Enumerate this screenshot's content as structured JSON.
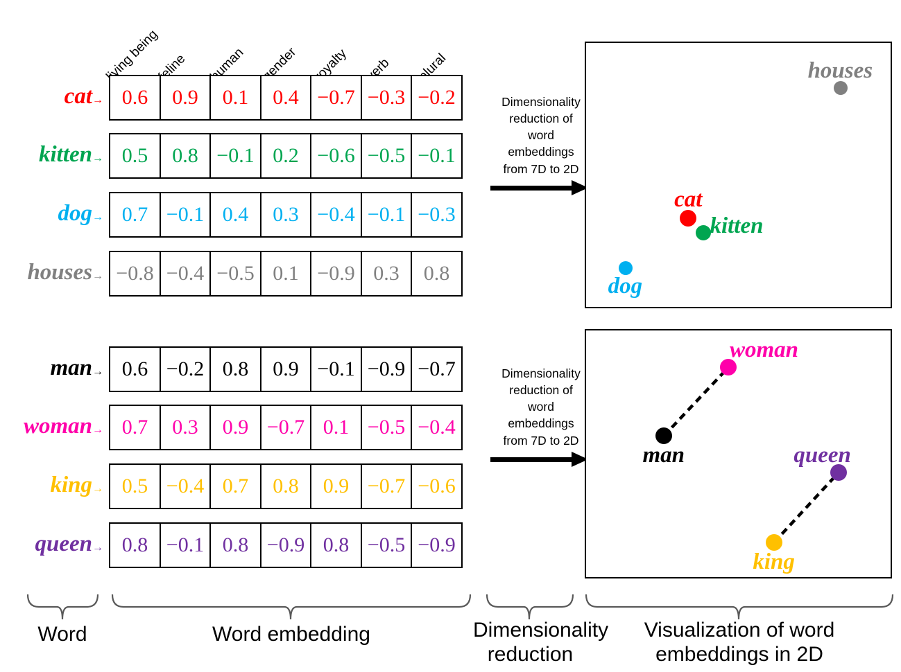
{
  "columns": [
    "living being",
    "feline",
    "human",
    "gender",
    "royalty",
    "verb",
    "plural"
  ],
  "group_top": {
    "rows": [
      {
        "word": "cat",
        "arrow": "→",
        "color": "#FF0000",
        "values": [
          "0.6",
          "0.9",
          "0.1",
          "0.4",
          "−0.7",
          "−0.3",
          "−0.2"
        ]
      },
      {
        "word": "kitten",
        "arrow": "→",
        "color": "#00A550",
        "values": [
          "0.5",
          "0.8",
          "−0.1",
          "0.2",
          "−0.6",
          "−0.5",
          "−0.1"
        ]
      },
      {
        "word": "dog",
        "arrow": "→",
        "color": "#00B0F0",
        "values": [
          "0.7",
          "−0.1",
          "0.4",
          "0.3",
          "−0.4",
          "−0.1",
          "−0.3"
        ]
      },
      {
        "word": "houses",
        "arrow": "→",
        "color": "#808080",
        "values": [
          "−0.8",
          "−0.4",
          "−0.5",
          "0.1",
          "−0.9",
          "0.3",
          "0.8"
        ]
      }
    ]
  },
  "group_bottom": {
    "rows": [
      {
        "word": "man",
        "arrow": "→",
        "color": "#000000",
        "values": [
          "0.6",
          "−0.2",
          "0.8",
          "0.9",
          "−0.1",
          "−0.9",
          "−0.7"
        ]
      },
      {
        "word": "woman",
        "arrow": "→",
        "color": "#FF00AA",
        "values": [
          "0.7",
          "0.3",
          "0.9",
          "−0.7",
          "0.1",
          "−0.5",
          "−0.4"
        ]
      },
      {
        "word": "king",
        "arrow": "→",
        "color": "#FFC000",
        "values": [
          "0.5",
          "−0.4",
          "0.7",
          "0.8",
          "0.9",
          "−0.7",
          "−0.6"
        ]
      },
      {
        "word": "queen",
        "arrow": "→",
        "color": "#7030A0",
        "values": [
          "0.8",
          "−0.1",
          "0.8",
          "−0.9",
          "0.8",
          "−0.5",
          "−0.9"
        ]
      }
    ]
  },
  "arrow_top": {
    "lines": [
      "Dimensionality",
      "reduction of",
      "word",
      "embeddings",
      "from 7D to 2D"
    ]
  },
  "arrow_bottom": {
    "lines": [
      "Dimensionality",
      "reduction of",
      "word",
      "embeddings",
      "from 7D to 2D"
    ]
  },
  "chart_data": [
    {
      "type": "scatter",
      "title": "",
      "xlabel": "",
      "ylabel": "",
      "xlim": [
        0,
        1
      ],
      "ylim": [
        0,
        1
      ],
      "grid": false,
      "legend": "none",
      "points": [
        {
          "label": "houses",
          "x": 0.835,
          "y": 0.83,
          "color": "#808080",
          "r": 10,
          "label_pos": "above"
        },
        {
          "label": "cat",
          "x": 0.335,
          "y": 0.335,
          "color": "#FF0000",
          "r": 12,
          "label_pos": "above"
        },
        {
          "label": "kitten",
          "x": 0.386,
          "y": 0.28,
          "color": "#00A550",
          "r": 11,
          "label_pos": "right"
        },
        {
          "label": "dog",
          "x": 0.129,
          "y": 0.146,
          "color": "#00B0F0",
          "r": 10,
          "label_pos": "below"
        }
      ],
      "connections": []
    },
    {
      "type": "scatter",
      "title": "",
      "xlabel": "",
      "ylabel": "",
      "xlim": [
        0,
        1
      ],
      "ylim": [
        0,
        1
      ],
      "grid": false,
      "legend": "none",
      "points": [
        {
          "label": "woman",
          "x": 0.467,
          "y": 0.85,
          "color": "#FF00AA",
          "r": 12,
          "label_pos": "above-right"
        },
        {
          "label": "man",
          "x": 0.255,
          "y": 0.572,
          "color": "#000000",
          "r": 12,
          "label_pos": "below"
        },
        {
          "label": "queen",
          "x": 0.83,
          "y": 0.425,
          "color": "#7030A0",
          "r": 12,
          "label_pos": "above-left"
        },
        {
          "label": "king",
          "x": 0.617,
          "y": 0.14,
          "color": "#FFC000",
          "r": 12,
          "label_pos": "below"
        }
      ],
      "connections": [
        {
          "from": "man",
          "to": "woman",
          "style": "dashed",
          "color": "#000000"
        },
        {
          "from": "king",
          "to": "queen",
          "style": "dashed",
          "color": "#000000"
        }
      ]
    }
  ],
  "captions": {
    "word": "Word",
    "word_embedding": "Word embedding",
    "dimensionality_reduction": "Dimensionality\nreduction",
    "visualization": "Visualization of word\nembeddings  in 2D"
  }
}
